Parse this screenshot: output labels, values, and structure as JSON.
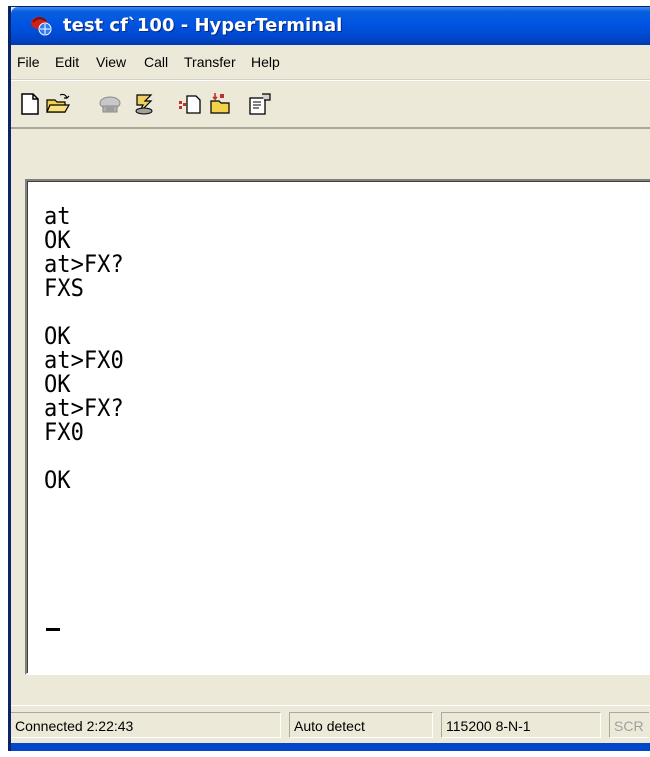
{
  "window": {
    "title": "test cf`100 - HyperTerminal",
    "app_icon": "hyperterminal-phone-icon"
  },
  "menu": {
    "items": [
      "File",
      "Edit",
      "View",
      "Call",
      "Transfer",
      "Help"
    ]
  },
  "toolbar": {
    "buttons": [
      {
        "icon": "new-document-icon",
        "label": "New"
      },
      {
        "icon": "open-folder-icon",
        "label": "Open"
      },
      {
        "icon": "call-icon",
        "label": "Call"
      },
      {
        "icon": "disconnect-icon",
        "label": "Disconnect"
      },
      {
        "icon": "send-icon",
        "label": "Send"
      },
      {
        "icon": "receive-icon",
        "label": "Receive"
      },
      {
        "icon": "properties-icon",
        "label": "Properties"
      }
    ]
  },
  "terminal": {
    "lines": [
      "at",
      "OK",
      "at>FX?",
      "FXS",
      "",
      "OK",
      "at>FX0",
      "OK",
      "at>FX?",
      "FX0",
      "",
      "OK"
    ]
  },
  "status": {
    "connection": "Connected 2:22:43",
    "detect": "Auto detect",
    "port_settings": "115200 8-N-1",
    "scroll": "SCR"
  },
  "colors": {
    "titlebar": "#0054e3",
    "chrome": "#ece9d8",
    "terminal_bg": "#ffffff",
    "terminal_text": "#000000"
  }
}
